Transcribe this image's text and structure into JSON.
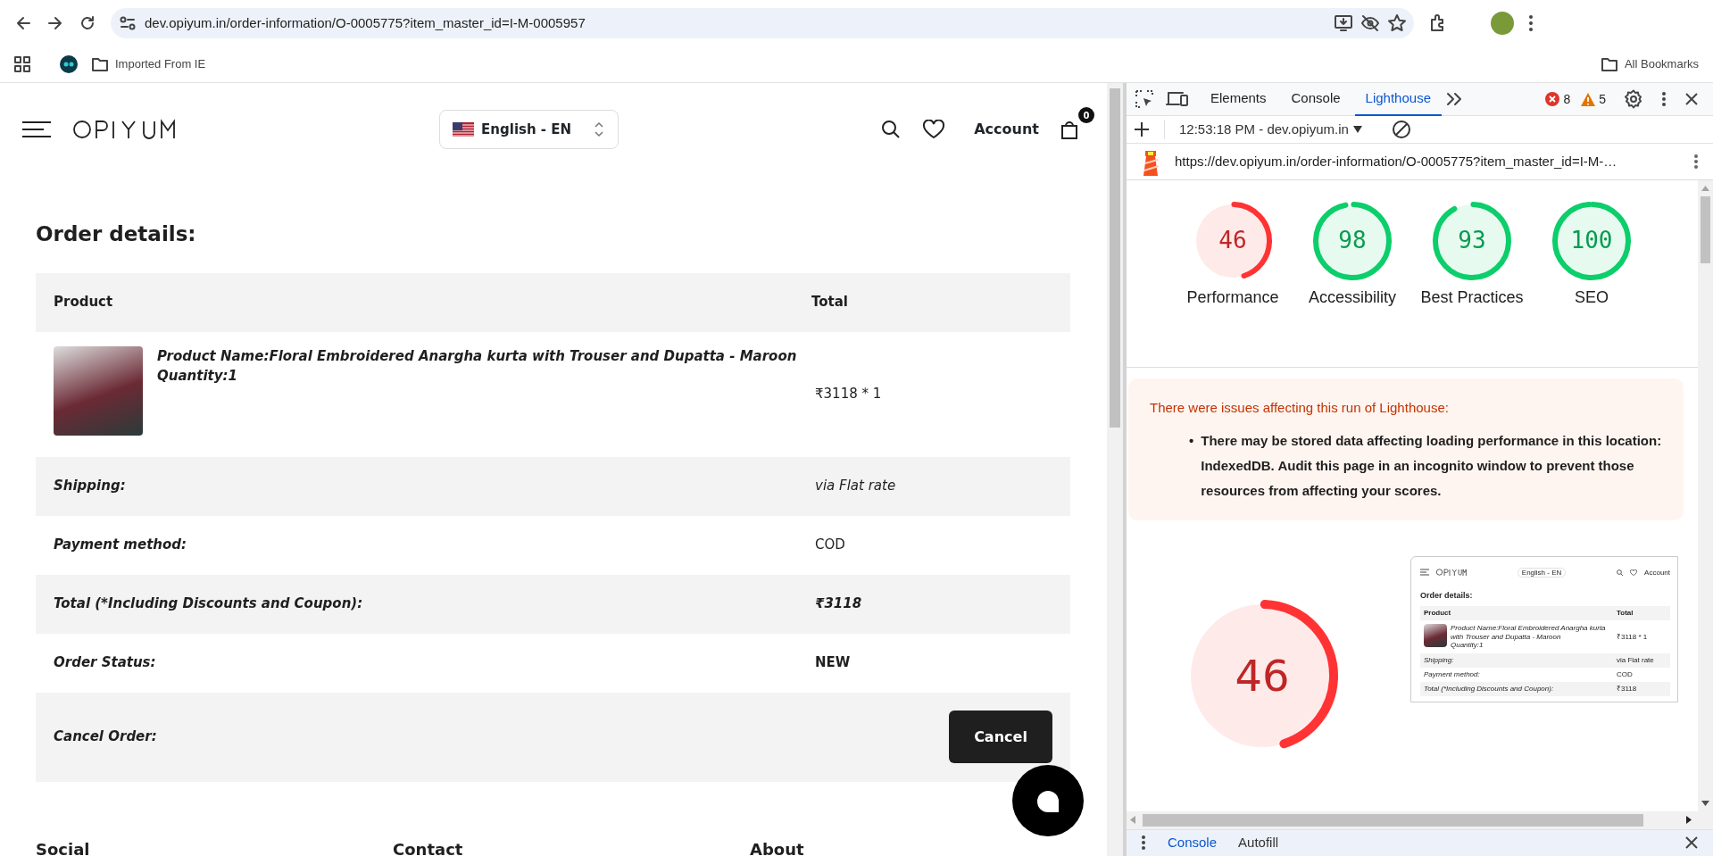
{
  "browser": {
    "address": "dev.opiyum.in/order-information/O-0005775?item_master_id=I-M-0005957",
    "bookmarks": [
      {
        "label": "Imported From IE"
      }
    ],
    "all_bookmarks": "All Bookmarks"
  },
  "site": {
    "language": "English - EN",
    "account": "Account",
    "cart_count": "0",
    "heading": "Order details:",
    "columns": [
      "Product",
      "Total"
    ],
    "product": {
      "name": "Product Name:Floral Embroidered Anargha kurta with Trouser and Dupatta - Maroon",
      "quantity": "Quantity:1",
      "total": "₹3118 * 1"
    },
    "rows": [
      {
        "label": "Shipping:",
        "value": "via Flat rate",
        "kind": "italic"
      },
      {
        "label": "Payment method:",
        "value": "COD",
        "kind": "plain"
      },
      {
        "label": "Total (*Including Discounts and Coupon):",
        "value": "₹3118",
        "kind": "bold-italic"
      },
      {
        "label": "Order Status:",
        "value": "NEW",
        "kind": "bold"
      }
    ],
    "cancel": {
      "label": "Cancel Order:",
      "button": "Cancel"
    },
    "footer": [
      "Social",
      "Contact",
      "About"
    ]
  },
  "devtools": {
    "tabs": [
      {
        "label": "Elements",
        "selected": false
      },
      {
        "label": "Console",
        "selected": false
      },
      {
        "label": "Lighthouse",
        "selected": true
      }
    ],
    "errors": "8",
    "warnings": "5",
    "report": "12:53:18 PM - dev.opiyum.in",
    "url": "https://dev.opiyum.in/order-information/O-0005775?item_master_id=I-M-…",
    "gauges": [
      {
        "score": "46",
        "label": "Performance",
        "level": 0.46,
        "color": "#ff3333"
      },
      {
        "score": "98",
        "label": "Accessibility",
        "level": 0.98,
        "color": "#0cce6b"
      },
      {
        "score": "93",
        "label": "Best Practices",
        "level": 0.93,
        "color": "#0cce6b"
      },
      {
        "score": "100",
        "label": "SEO",
        "level": 1,
        "color": "#0cce6b"
      }
    ],
    "warning": {
      "title": "There were issues affecting this run of Lighthouse:",
      "bullet": "•",
      "items": [
        "There may be stored data affecting loading performance in this location: IndexedDB. Audit this page in an incognito window to prevent those resources from affecting your scores."
      ]
    },
    "big_gauge": {
      "score": "46",
      "level": 0.46,
      "color": "#ff3333"
    },
    "thumbnail": {
      "language": "English - EN",
      "account": "Account",
      "heading": "Order details:",
      "columns": [
        "Product",
        "Total"
      ],
      "product_name": "Product Name:Floral Embroidered Anargha kurta with Trouser and Dupatta - Maroon",
      "quantity": "Quantity:1",
      "product_total": "₹3118 * 1",
      "rows": [
        {
          "label": "Shipping:",
          "value": "via Flat rate"
        },
        {
          "label": "Payment method:",
          "value": "COD"
        },
        {
          "label": "Total (*Including Discounts and Coupon):",
          "value": "₹3118"
        }
      ]
    },
    "drawer_tabs": [
      {
        "label": "Console",
        "selected": true
      },
      {
        "label": "Autofill",
        "selected": false
      }
    ]
  }
}
